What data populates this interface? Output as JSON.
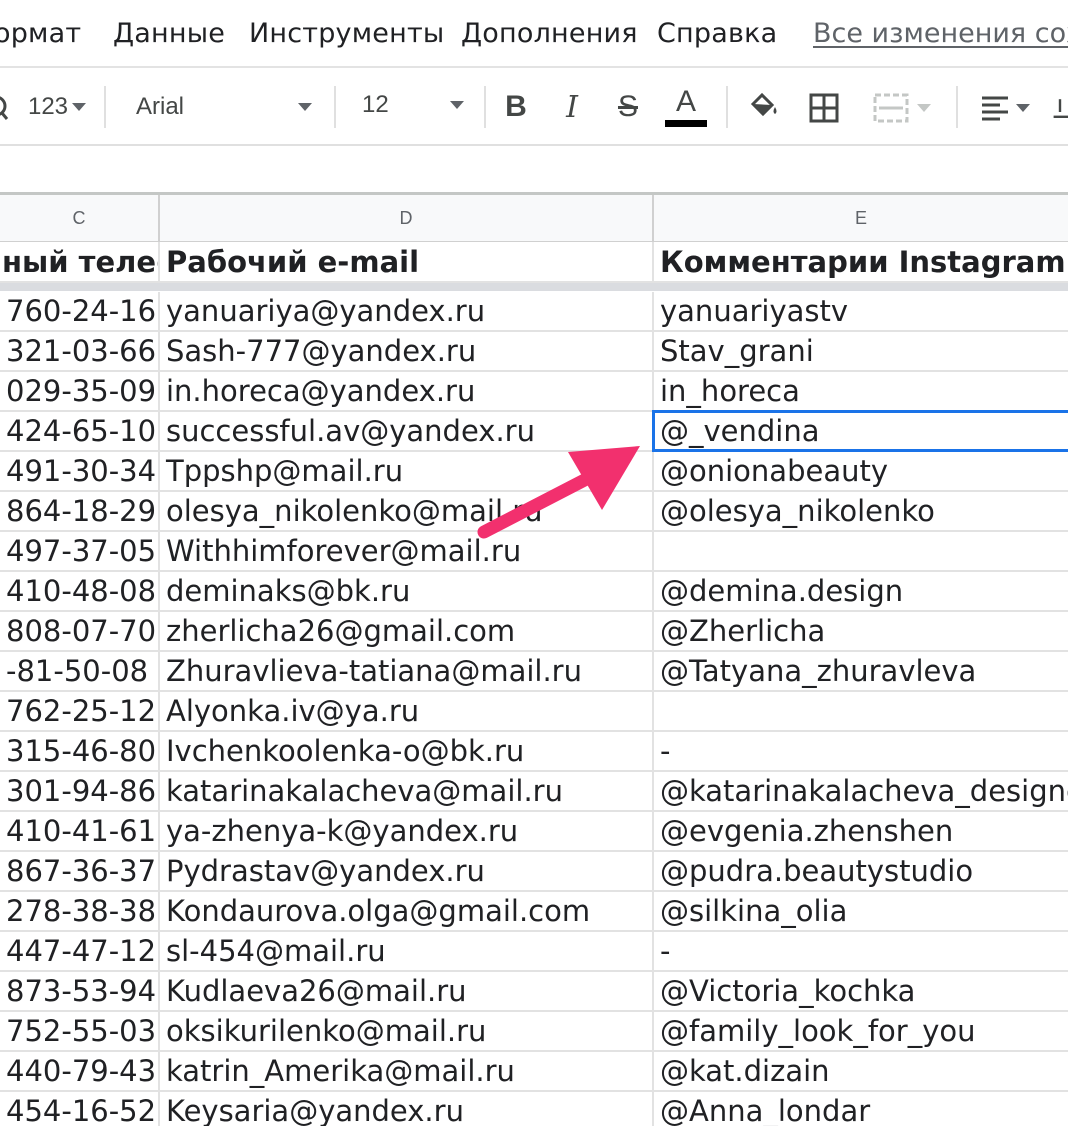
{
  "menu": {
    "items": [
      "ормат",
      "Данные",
      "Инструменты",
      "Дополнения",
      "Справка"
    ],
    "save_status": "Все изменения сохр"
  },
  "toolbar": {
    "number_format": "123",
    "font_name": "Arial",
    "font_size": "12",
    "bold": "B",
    "italic": "I",
    "strikethrough": "S",
    "text_color": "A",
    "text_color_value": "#000000"
  },
  "columns": {
    "c": "C",
    "d": "D",
    "e": "E"
  },
  "sheet": {
    "header": {
      "c": "ный телеф",
      "d": "Рабочий e-mail",
      "e": "Комментарии Instagram"
    },
    "rows": [
      {
        "c": "760-24-16",
        "d": "yanuariya@yandex.ru",
        "e": "yanuariyastv"
      },
      {
        "c": "321-03-66",
        "d": "Sash-777@yandex.ru",
        "e": "Stav_grani"
      },
      {
        "c": "029-35-09",
        "d": "in.horeca@yandex.ru",
        "e": "in_horeca"
      },
      {
        "c": "424-65-10",
        "d": "successful.av@yandex.ru",
        "e": "@_vendina"
      },
      {
        "c": "491-30-34",
        "d": "Tppshp@mail.ru",
        "e": "@onionabeauty"
      },
      {
        "c": "864-18-29",
        "d": "olesya_nikolenko@mail.ru",
        "e": "@olesya_nikolenko"
      },
      {
        "c": "497-37-05",
        "d": "Withhimforever@mail.ru",
        "e": ""
      },
      {
        "c": "410-48-08",
        "d": "deminaks@bk.ru",
        "e": "@demina.design"
      },
      {
        "c": "808-07-70",
        "d": "zherlicha26@gmail.com",
        "e": "@Zherlicha"
      },
      {
        "c": "-81-50-08",
        "d": "Zhuravlieva-tatiana@mail.ru",
        "e": "@Tatyana_zhuravleva"
      },
      {
        "c": "762-25-12",
        "d": "Alyonka.iv@ya.ru",
        "e": ""
      },
      {
        "c": "315-46-80",
        "d": "Ivchenkoolenka-o@bk.ru",
        "e": "-"
      },
      {
        "c": "301-94-86",
        "d": "katarinakalacheva@mail.ru",
        "e": "@katarinakalacheva_designe"
      },
      {
        "c": "410-41-61",
        "d": "ya-zhenya-k@yandex.ru",
        "e": "@evgenia.zhenshen"
      },
      {
        "c": "867-36-37",
        "d": "Pydrastav@yandex.ru",
        "e": "@pudra.beautystudio"
      },
      {
        "c": "278-38-38",
        "d": "Kondaurova.olga@gmail.com",
        "e": "@silkina_olia"
      },
      {
        "c": "447-47-12",
        "d": "sl-454@mail.ru",
        "e": "-"
      },
      {
        "c": "873-53-94",
        "d": "Kudlaeva26@mail.ru",
        "e": "@Victoria_kochka"
      },
      {
        "c": "752-55-03",
        "d": "oksikurilenko@mail.ru",
        "e": "@family_look_for_you"
      },
      {
        "c": "440-79-43",
        "d": "katrin_Amerika@mail.ru",
        "e": "@kat.dizain"
      },
      {
        "c": "454-16-52",
        "d": "Keysaria@yandex.ru",
        "e": "@Anna_londar"
      }
    ]
  },
  "annotation": {
    "arrow_color": "#f2306e"
  },
  "colors": {
    "selection": "#1a73e8",
    "gridline": "#e2e2e2",
    "header_bg": "#f8f9fa"
  }
}
